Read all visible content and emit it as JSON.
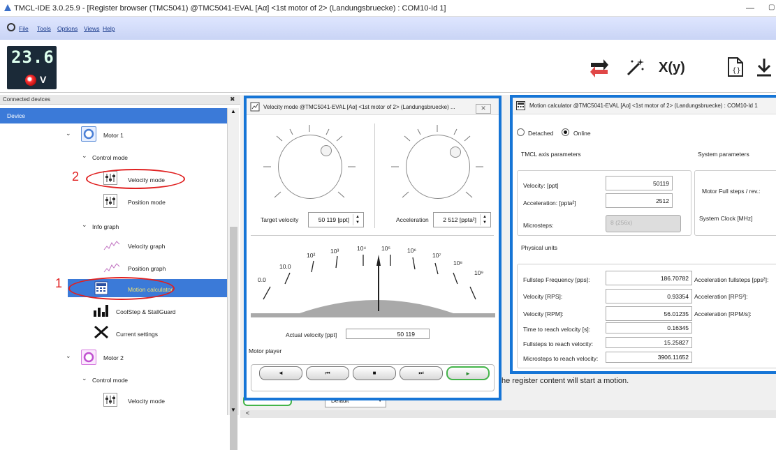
{
  "window": {
    "title": "TMCL-IDE 3.0.25.9 - [Register browser (TMC5041) @TMC5041-EVAL [Aα] <1st motor of 2> (Landungsbruecke) : COM10-Id 1]"
  },
  "menu": [
    "File",
    "Tools",
    "Options",
    "Views",
    "Help"
  ],
  "lcd": {
    "value": "23.6",
    "unit": "V"
  },
  "toolbar": {
    "icons": [
      "swap-icon",
      "magic-wand-icon",
      "function-icon",
      "document-icon",
      "download-icon"
    ],
    "func_label": "X(y)"
  },
  "left": {
    "panel_title": "Connected devices",
    "close_glyph": "✖",
    "section": "Device",
    "motor1": "Motor 1",
    "control_mode": "Control mode",
    "velocity_mode": "Velocity mode",
    "position_mode": "Position mode",
    "info_graph": "Info graph",
    "velocity_graph": "Velocity graph",
    "position_graph": "Position graph",
    "motion_calculator": "Motion calculator",
    "coolstep": "CoolStep & StallGuard",
    "current_settings": "Current settings",
    "motor2": "Motor 2",
    "control_mode2": "Control mode",
    "velocity_mode2": "Velocity mode",
    "annot1": "1",
    "annot2": "2"
  },
  "velocity_window": {
    "title": "Velocity mode @TMC5041-EVAL [Aα] <1st motor of 2> (Landungsbruecke) ...",
    "target_label": "Target velocity",
    "target_value": "50 119 [ppt]",
    "accel_label": "Acceleration",
    "accel_value": "2 512 [ppta²]",
    "gauge_labels": [
      "0.0",
      "10.0",
      "10²",
      "10³",
      "10⁴",
      "10⁵",
      "10⁶",
      "10⁷",
      "10⁸",
      "10⁹"
    ],
    "actual_label": "Actual velocity [ppt]",
    "actual_value": "50 119",
    "player_label": "Motor player",
    "buttons": [
      "◄",
      "⏮",
      "■",
      "⏭",
      "►"
    ]
  },
  "motion_window": {
    "title": "Motion calculator @TMC5041-EVAL [Aα] <1st motor of 2> (Landungsbruecke) : COM10-Id 1",
    "detached": "Detached",
    "online": "Online",
    "tmcl_header": "TMCL axis parameters",
    "system_header": "System parameters",
    "velocity_label": "Velocity: [ppt]",
    "velocity_value": "50119",
    "accel_label": "Acceleration: [ppta²]",
    "accel_value": "2512",
    "microsteps_label": "Microsteps:",
    "microsteps_value": "8 (256x)",
    "motor_fullsteps": "Motor Full steps / rev.:",
    "system_clock": "System Clock [MHz]",
    "physical_header": "Physical units",
    "rows": [
      {
        "label": "Fullstep Frequency [pps]:",
        "value": "186.70782",
        "right": "Acceleration fullsteps [pps²]:"
      },
      {
        "label": "Velocity [RPS]:",
        "value": "0.93354",
        "right": "Acceleration [RPS²]:"
      },
      {
        "label": "Velocity [RPM]:",
        "value": "56.01235",
        "right": "Acceleration [RPM/s]:"
      },
      {
        "label": "Time to reach velocity [s]:",
        "value": "0.16345",
        "right": ""
      },
      {
        "label": "Fullsteps to reach velocity:",
        "value": "15.25827",
        "right": ""
      },
      {
        "label": "Microsteps to reach velocity:",
        "value": "3906.11652",
        "right": ""
      }
    ]
  },
  "register_hint": "he register content will start a motion.",
  "register_bottom": "Default"
}
